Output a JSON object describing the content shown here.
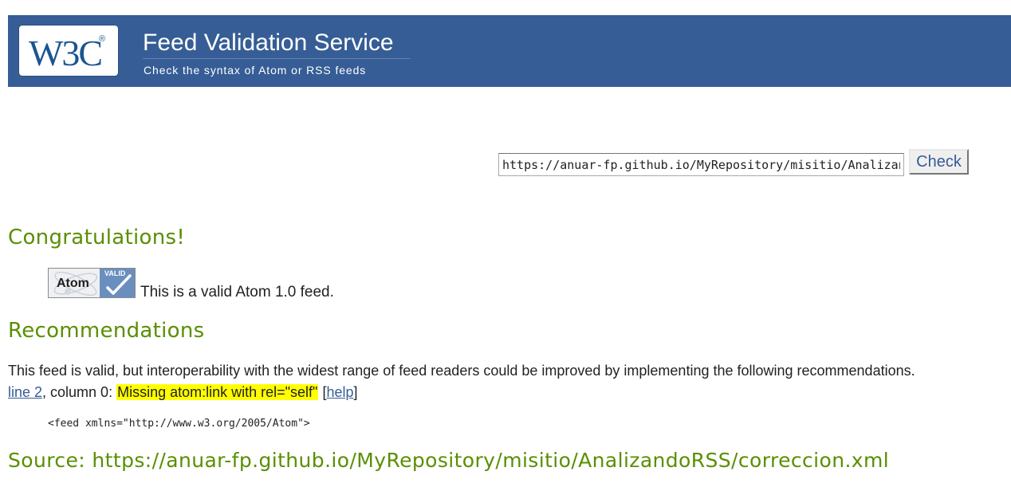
{
  "header": {
    "logo_text": "W3C",
    "logo_mark": "®",
    "title": "Feed Validation Service",
    "subtitle": "Check the syntax of Atom or RSS feeds"
  },
  "form": {
    "url_value": "https://anuar-fp.github.io/MyRepository/misitio/AnalizandoRSS/correccion.xml",
    "check_label": "Check"
  },
  "result": {
    "congrats_heading": "Congratulations!",
    "badge_word": "Atom",
    "badge_tag": "VALID",
    "valid_message": "This is a valid Atom 1.0 feed."
  },
  "recommendations": {
    "heading": "Recommendations",
    "intro": "This feed is valid, but interoperability with the widest range of feed readers could be improved by implementing the following recommendations.",
    "issue": {
      "line_link": "line 2",
      "column_text": ", column 0: ",
      "message": "Missing atom:link with rel=\"self\"",
      "help_open": " [",
      "help_link": "help",
      "help_close": "]"
    },
    "code": "<feed xmlns=\"http://www.w3.org/2005/Atom\">"
  },
  "source": {
    "label": "Source: https://anuar-fp.github.io/MyRepository/misitio/AnalizandoRSS/correccion.xml"
  },
  "colors": {
    "banner": "#365d95",
    "heading_green": "#5a8f00",
    "highlight": "#ffff00",
    "link": "#365d95"
  }
}
